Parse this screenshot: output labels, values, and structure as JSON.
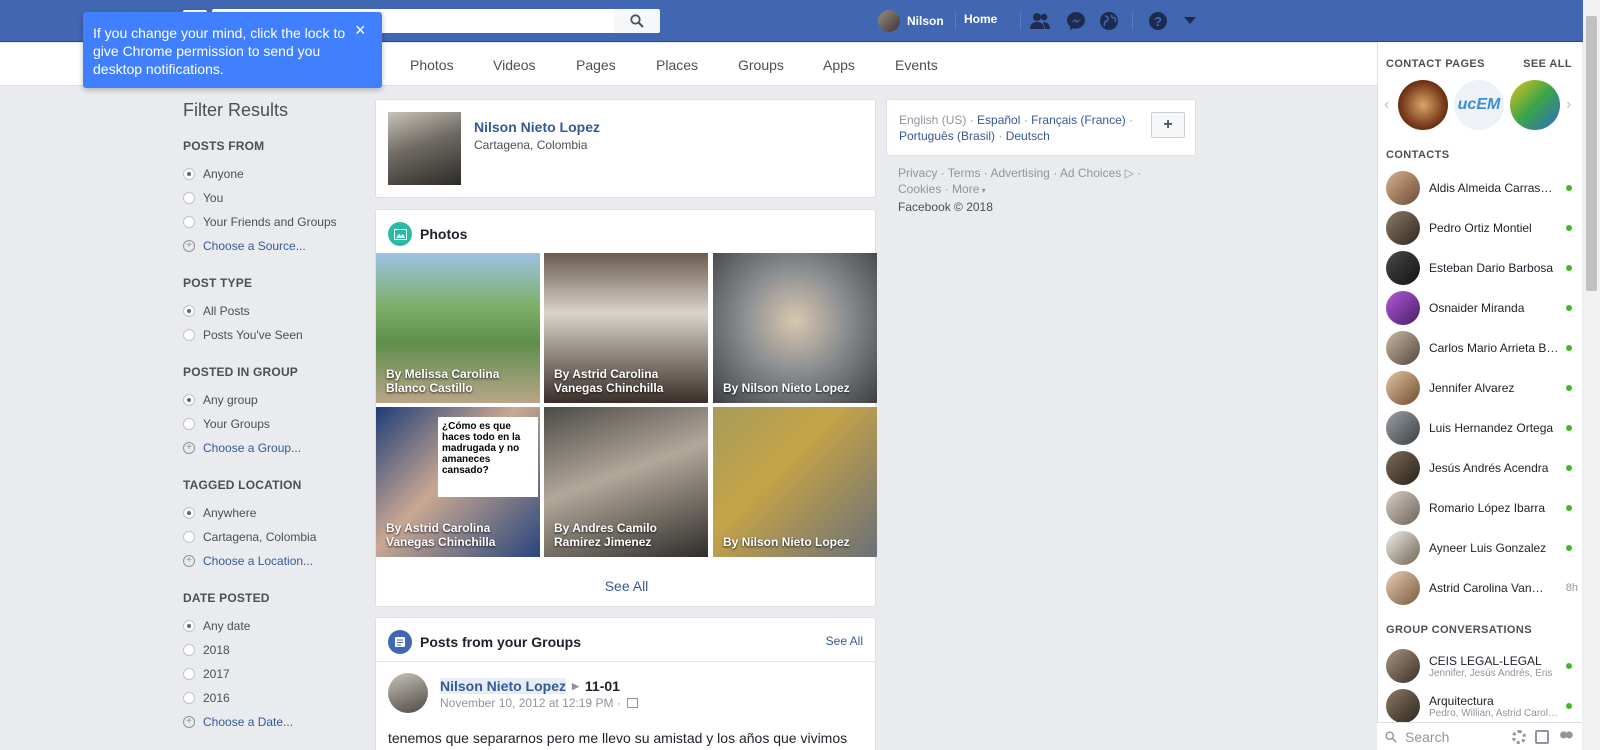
{
  "topbar": {
    "user_name": "Nilson",
    "home": "Home",
    "search_placeholder": ""
  },
  "tooltip": {
    "text": "If you change your mind, click the lock to give Chrome permission to send you desktop notifications.",
    "close": "×"
  },
  "tabs": [
    "Photos",
    "Videos",
    "Pages",
    "Places",
    "Groups",
    "Apps",
    "Events"
  ],
  "filters": {
    "title": "Filter Results",
    "groups": [
      {
        "head": "POSTS FROM",
        "options": [
          {
            "label": "Anyone",
            "on": true
          },
          {
            "label": "You",
            "on": false
          },
          {
            "label": "Your Friends and Groups",
            "on": false
          }
        ],
        "choose": "Choose a Source..."
      },
      {
        "head": "POST TYPE",
        "options": [
          {
            "label": "All Posts",
            "on": true
          },
          {
            "label": "Posts You've Seen",
            "on": false
          }
        ],
        "choose": ""
      },
      {
        "head": "POSTED IN GROUP",
        "options": [
          {
            "label": "Any group",
            "on": true
          },
          {
            "label": "Your Groups",
            "on": false
          }
        ],
        "choose": "Choose a Group..."
      },
      {
        "head": "TAGGED LOCATION",
        "options": [
          {
            "label": "Anywhere",
            "on": true
          },
          {
            "label": "Cartagena, Colombia",
            "on": false
          }
        ],
        "choose": "Choose a Location..."
      },
      {
        "head": "DATE POSTED",
        "options": [
          {
            "label": "Any date",
            "on": true
          },
          {
            "label": "2018",
            "on": false
          },
          {
            "label": "2017",
            "on": false
          },
          {
            "label": "2016",
            "on": false
          }
        ],
        "choose": "Choose a Date..."
      }
    ]
  },
  "profile": {
    "name": "Nilson Nieto Lopez",
    "location": "Cartagena, Colombia"
  },
  "photos": {
    "title": "Photos",
    "see_all": "See All",
    "items": [
      {
        "caption": "By Melissa Carolina Blanco Castillo"
      },
      {
        "caption": "By Astrid Carolina Vanegas Chinchilla"
      },
      {
        "caption": "By Nilson Nieto Lopez"
      },
      {
        "caption": "By Astrid Carolina Vanegas Chinchilla",
        "meme": "¿Cómo es que haces todo en la madrugada y no amaneces cansado?"
      },
      {
        "caption": "By Andres Camilo Ramirez Jimenez"
      },
      {
        "caption": "By Nilson Nieto Lopez"
      }
    ]
  },
  "group_posts": {
    "title": "Posts from your Groups",
    "see_all": "See All",
    "author": "Nilson Nieto Lopez",
    "target": "11-01",
    "date": "November 10, 2012 at 12:19 PM ·",
    "text": "tenemos que separarnos pero me llevo su amistad y los años que vivimos"
  },
  "languages": {
    "current": "English (US)",
    "others": [
      "Español",
      "Français (France)",
      "Português (Brasil)",
      "Deutsch"
    ],
    "add": "+"
  },
  "footer": {
    "links": [
      "Privacy",
      "Terms",
      "Advertising",
      "Ad Choices",
      "Cookies",
      "More"
    ],
    "copyright": "Facebook © 2018"
  },
  "chat": {
    "contact_pages_title": "CONTACT PAGES",
    "see_all": "SEE ALL",
    "contacts_title": "CONTACTS",
    "contacts": [
      {
        "name": "Aldis Almeida Carrasquilla",
        "time": ""
      },
      {
        "name": "Pedro Ortiz Montiel",
        "time": ""
      },
      {
        "name": "Esteban Dario Barbosa",
        "time": ""
      },
      {
        "name": "Osnaider Miranda",
        "time": ""
      },
      {
        "name": "Carlos Mario Arrieta Bustillo",
        "time": ""
      },
      {
        "name": "Jennifer Alvarez",
        "time": ""
      },
      {
        "name": "Luis Hernandez Ortega",
        "time": ""
      },
      {
        "name": "Jesús Andrés Acendra",
        "time": ""
      },
      {
        "name": "Romario López Ibarra",
        "time": ""
      },
      {
        "name": "Ayneer Luis Gonzalez",
        "time": ""
      },
      {
        "name": "Astrid Carolina Vanegas",
        "time": "8h"
      }
    ],
    "group_title": "GROUP CONVERSATIONS",
    "groups": [
      {
        "name": "CEIS LEGAL-LEGAL",
        "members": "Jennifer, Jesús Andrés, Eris"
      },
      {
        "name": "Arquitectura",
        "members": "Pedro, Willian, Astrid Carolina"
      }
    ],
    "search_placeholder": "Search"
  },
  "colors": {
    "brand": "#4267b2",
    "link": "#365899",
    "tooltip": "#4080ff",
    "online": "#42b72a"
  }
}
